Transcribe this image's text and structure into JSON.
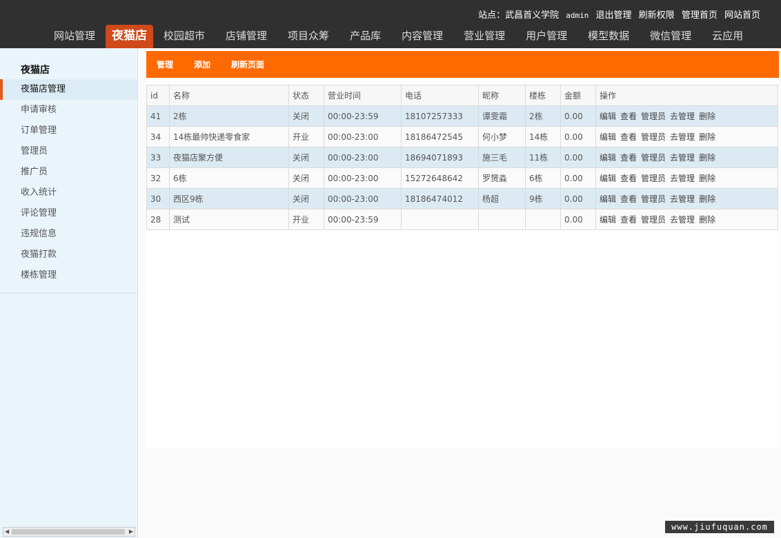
{
  "header": {
    "site_label": "站点：武昌首义学院",
    "user": "admin",
    "links": [
      "退出管理",
      "刷新权限",
      "管理首页",
      "网站首页"
    ]
  },
  "nav": [
    {
      "label": "网站管理",
      "active": false
    },
    {
      "label": "夜猫店",
      "active": true
    },
    {
      "label": "校园超市",
      "active": false
    },
    {
      "label": "店铺管理",
      "active": false
    },
    {
      "label": "项目众筹",
      "active": false
    },
    {
      "label": "产品库",
      "active": false
    },
    {
      "label": "内容管理",
      "active": false
    },
    {
      "label": "营业管理",
      "active": false
    },
    {
      "label": "用户管理",
      "active": false
    },
    {
      "label": "模型数据",
      "active": false
    },
    {
      "label": "微信管理",
      "active": false
    },
    {
      "label": "云应用",
      "active": false
    }
  ],
  "sidebar": {
    "title": "夜猫店",
    "items": [
      {
        "label": "夜猫店管理",
        "active": true
      },
      {
        "label": "申请审核",
        "active": false
      },
      {
        "label": "订单管理",
        "active": false
      },
      {
        "label": "管理员",
        "active": false
      },
      {
        "label": "推广员",
        "active": false
      },
      {
        "label": "收入统计",
        "active": false
      },
      {
        "label": "评论管理",
        "active": false
      },
      {
        "label": "违规信息",
        "active": false
      },
      {
        "label": "夜猫打款",
        "active": false
      },
      {
        "label": "楼栋管理",
        "active": false
      }
    ]
  },
  "toolbar": {
    "manage": "管理",
    "add": "添加",
    "refresh": "刷新页面"
  },
  "table": {
    "columns": [
      "id",
      "名称",
      "状态",
      "营业时间",
      "电话",
      "昵称",
      "楼栋",
      "金额",
      "操作"
    ],
    "actions": [
      "编辑",
      "查看",
      "管理员",
      "去管理",
      "删除"
    ],
    "rows": [
      {
        "id": "41",
        "name": "2栋",
        "status": "关闭",
        "hours": "00:00-23:59",
        "phone": "18107257333",
        "nickname": "谭雯霜",
        "building": "2栋",
        "amount": "0.00"
      },
      {
        "id": "34",
        "name": "14栋最帅快递零食家",
        "status": "开业",
        "hours": "00:00-23:00",
        "phone": "18186472545",
        "nickname": "何小梦",
        "building": "14栋",
        "amount": "0.00"
      },
      {
        "id": "33",
        "name": "夜猫店聚方便",
        "status": "关闭",
        "hours": "00:00-23:00",
        "phone": "18694071893",
        "nickname": "施三毛",
        "building": "11栋",
        "amount": "0.00"
      },
      {
        "id": "32",
        "name": "6栋",
        "status": "关闭",
        "hours": "00:00-23:00",
        "phone": "15272648642",
        "nickname": "罗赟淼",
        "building": "6栋",
        "amount": "0.00"
      },
      {
        "id": "30",
        "name": "西区9栋",
        "status": "关闭",
        "hours": "00:00-23:00",
        "phone": "18186474012",
        "nickname": "杨超",
        "building": "9栋",
        "amount": "0.00"
      },
      {
        "id": "28",
        "name": "测试",
        "status": "开业",
        "hours": "00:00-23:59",
        "phone": "",
        "nickname": "",
        "building": "",
        "amount": "0.00"
      }
    ]
  },
  "watermark": "www.jiufuquan.com"
}
